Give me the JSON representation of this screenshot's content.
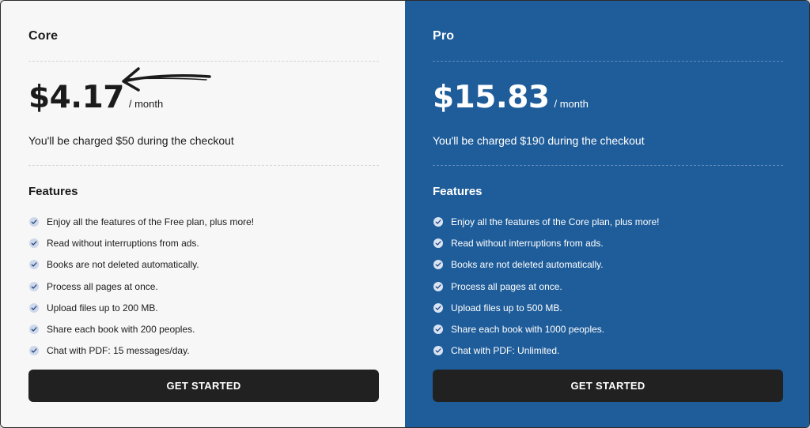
{
  "plans": [
    {
      "name": "Core",
      "price": "$4.17",
      "period": "/ month",
      "charge": "You'll be charged $50 during the checkout",
      "features_title": "Features",
      "features": [
        "Enjoy all the features of the Free plan, plus more!",
        "Read without interruptions from ads.",
        "Books are not deleted automatically.",
        "Process all pages at once.",
        "Upload files up to 200 MB.",
        "Share each book with 200 peoples.",
        "Chat with PDF: 15 messages/day."
      ],
      "cta": "GET STARTED",
      "background": "#f7f7f7"
    },
    {
      "name": "Pro",
      "price": "$15.83",
      "period": "/ month",
      "charge": "You'll be charged $190 during the checkout",
      "features_title": "Features",
      "features": [
        "Enjoy all the features of the Core plan, plus more!",
        "Read without interruptions from ads.",
        "Books are not deleted automatically.",
        "Process all pages at once.",
        "Upload files up to 500 MB.",
        "Share each book with 1000 peoples.",
        "Chat with PDF: Unlimited."
      ],
      "cta": "GET STARTED",
      "background": "#1f5d9a"
    }
  ],
  "icons": {
    "feature_bullet": "check-circle-icon",
    "annotation": "hand-drawn-arrow-icon"
  },
  "colors": {
    "button": "#212121",
    "check_badge": "#cdd8ea"
  }
}
